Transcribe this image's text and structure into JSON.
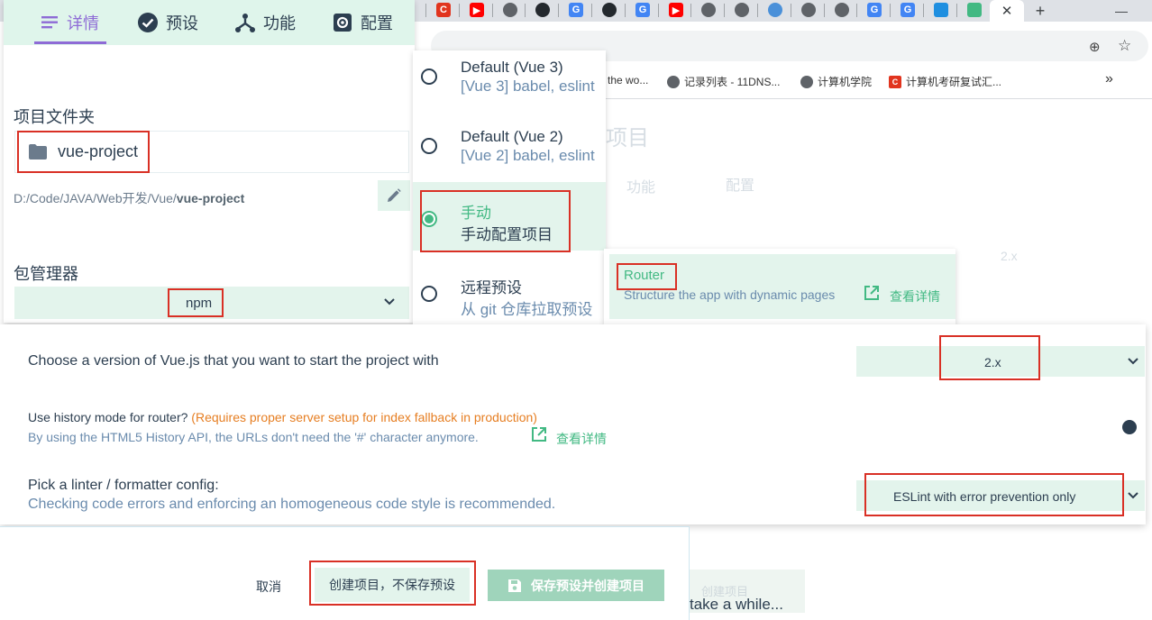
{
  "browser": {
    "tabs": [
      {
        "icon": "csdn-icon",
        "letter": "C",
        "color": "#e1341e"
      },
      {
        "icon": "youtube-icon",
        "letter": "▶",
        "color": "#ff0000"
      },
      {
        "icon": "globe-icon",
        "letter": "",
        "color": "#5f6368"
      },
      {
        "icon": "github-icon",
        "letter": "",
        "color": "#24292e"
      },
      {
        "icon": "google-icon",
        "letter": "G",
        "color": "#4285f4"
      },
      {
        "icon": "github-icon",
        "letter": "",
        "color": "#24292e"
      },
      {
        "icon": "google-icon",
        "letter": "G",
        "color": "#4285f4"
      },
      {
        "icon": "youtube-icon",
        "letter": "▶",
        "color": "#ff0000"
      },
      {
        "icon": "globe-icon",
        "letter": "",
        "color": "#5f6368"
      },
      {
        "icon": "globe-icon",
        "letter": "",
        "color": "#5f6368"
      },
      {
        "icon": "cloud-icon",
        "letter": "",
        "color": "#4a90d9"
      },
      {
        "icon": "globe-icon",
        "letter": "",
        "color": "#5f6368"
      },
      {
        "icon": "globe-icon",
        "letter": "",
        "color": "#5f6368"
      },
      {
        "icon": "google-icon",
        "letter": "G",
        "color": "#4285f4"
      },
      {
        "icon": "google-icon",
        "letter": "G",
        "color": "#4285f4"
      },
      {
        "icon": "edge-icon",
        "letter": "",
        "color": "#1f8fe0"
      },
      {
        "icon": "vue-icon",
        "letter": "",
        "color": "#42b983"
      }
    ],
    "active_tab_close": "✕",
    "new_tab": "+",
    "minimize": "—",
    "bookmarks": [
      {
        "label": "the wo...",
        "color": "#5f6368"
      },
      {
        "label": "记录列表 - 11DNS...",
        "color": "#5f6368"
      },
      {
        "label": "计算机学院",
        "color": "#5f6368"
      },
      {
        "label": "计算机考研复试汇...",
        "color": "#e1341e"
      }
    ],
    "bookmarks_more": "»"
  },
  "background": {
    "title_fragment": "项目",
    "tab_func": "功能",
    "tab_config": "配置",
    "vue_version": "2.x",
    "bottom_btn": "创建项目",
    "loading_text": "take a while..."
  },
  "header": {
    "tabs": [
      {
        "label": "详情",
        "icon": "details-icon",
        "active": true
      },
      {
        "label": "预设",
        "icon": "check-circle-icon",
        "active": false
      },
      {
        "label": "功能",
        "icon": "features-icon",
        "active": false
      },
      {
        "label": "配置",
        "icon": "settings-icon",
        "active": false
      }
    ]
  },
  "details": {
    "folder_label": "项目文件夹",
    "folder_value": "vue-project",
    "path_prefix": "D:/Code/JAVA/Web开发/Vue/",
    "path_folder": "vue-project",
    "package_manager_label": "包管理器",
    "package_manager_value": "npm"
  },
  "presets": [
    {
      "name": "Default (Vue 3)",
      "desc": "[Vue 3] babel, eslint",
      "selected": false
    },
    {
      "name": "Default (Vue 2)",
      "desc": "[Vue 2] babel, eslint",
      "selected": false
    },
    {
      "name": "手动",
      "desc": "手动配置项目",
      "selected": true
    },
    {
      "name": "远程预设",
      "desc": "从 git 仓库拉取预设",
      "selected": false
    }
  ],
  "router": {
    "name": "Router",
    "desc": "Structure the app with dynamic pages",
    "more": "查看详情"
  },
  "config": {
    "vue_version_label": "Choose a version of Vue.js that you want to start the project with",
    "vue_version_value": "2.x",
    "history_label": "Use history mode for router?",
    "history_warning": "(Requires proper server setup for index fallback in production)",
    "history_desc": "By using the HTML5 History API, the URLs don't need the '#' character anymore.",
    "history_more": "查看详情",
    "history_enabled": true,
    "linter_label": "Pick a linter / formatter config:",
    "linter_desc": "Checking code errors and enforcing an homogeneous code style is recommended.",
    "linter_value": "ESLint with error prevention only"
  },
  "actions": {
    "cancel": "取消",
    "create": "创建项目，不保存预设",
    "save_create": "保存预设并创建项目"
  },
  "colors": {
    "accent": "#42b983",
    "accent_light": "#e3f4ec",
    "tab_active": "#8e6bd6",
    "text": "#2c3e50",
    "muted": "#6a8bad",
    "warning": "#e67e22",
    "highlight": "#d93025"
  }
}
